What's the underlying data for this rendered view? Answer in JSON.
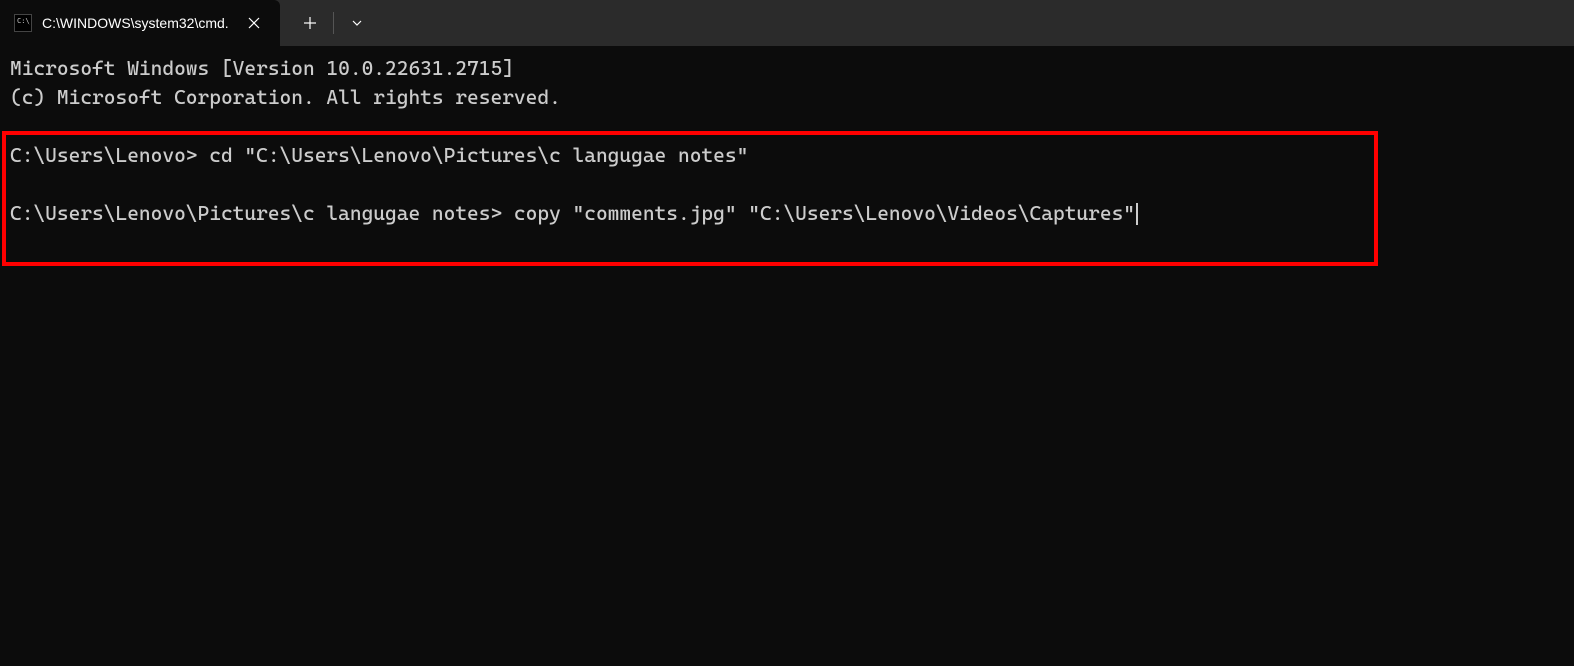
{
  "tab": {
    "title": "C:\\WINDOWS\\system32\\cmd.",
    "icon_glyph": "⧉"
  },
  "terminal": {
    "header_line1": "Microsoft Windows [Version 10.0.22631.2715]",
    "header_line2": "(c) Microsoft Corporation. All rights reserved.",
    "prompt1": "C:\\Users\\Lenovo> ",
    "command1": "cd \"C:\\Users\\Lenovo\\Pictures\\c langugae notes\"",
    "prompt2": "C:\\Users\\Lenovo\\Pictures\\c langugae notes> ",
    "command2": "copy \"comments.jpg\" \"C:\\Users\\Lenovo\\Videos\\Captures\""
  }
}
